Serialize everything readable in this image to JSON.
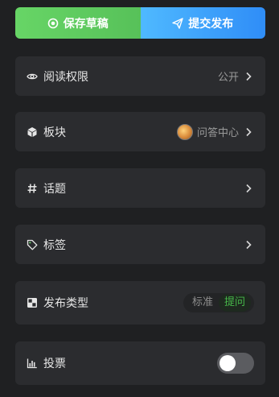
{
  "actions": {
    "save_draft": "保存草稿",
    "submit_publish": "提交发布"
  },
  "settings": {
    "read_permission": {
      "label": "阅读权限",
      "value": "公开"
    },
    "section": {
      "label": "板块",
      "value": "问答中心"
    },
    "topic": {
      "label": "话题"
    },
    "tags": {
      "label": "标签"
    },
    "publish_type": {
      "label": "发布类型",
      "options": [
        "标准",
        "提问"
      ],
      "selected": "提问"
    },
    "vote": {
      "label": "投票",
      "enabled": false
    }
  },
  "colors": {
    "draft_green": "#5cc95d",
    "publish_blue": "#3a9af8",
    "accent_green": "#47b94a"
  }
}
